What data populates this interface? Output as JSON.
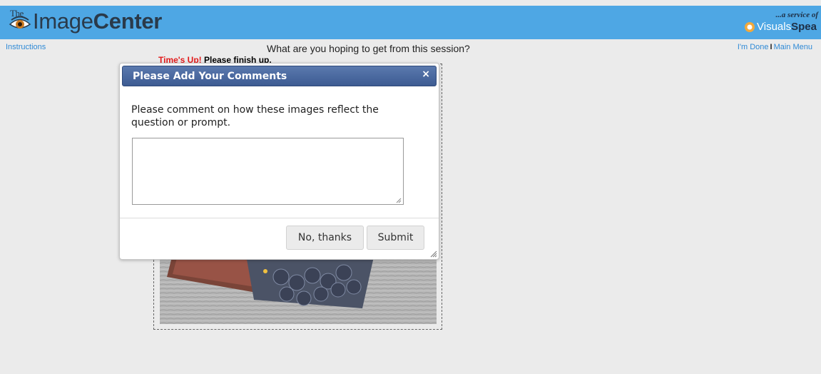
{
  "header": {
    "logo_prefix": "The",
    "logo_image": "Image",
    "logo_center": "Center",
    "service_tagline": "...a service of",
    "service_brand_light": "Visuals",
    "service_brand_bold": "Spea"
  },
  "nav": {
    "instructions": "Instructions",
    "done": "I'm Done",
    "separator": "I",
    "main_menu": "Main Menu"
  },
  "question": "What are you hoping to get from this session?",
  "timer": {
    "alert": "Time's Up!",
    "message": "Please finish up."
  },
  "dialog": {
    "title": "Please Add Your Comments",
    "close": "×",
    "prompt": "Please comment on how these images reflect the question or prompt.",
    "comment_value": "",
    "no_thanks_label": "No, thanks",
    "submit_label": "Submit"
  },
  "icons": [
    "eye-icon",
    "visuals-speak-logo-icon",
    "close-icon",
    "resize-grip-icon"
  ],
  "colors": {
    "header_bg": "#4ea7e4",
    "page_bg": "#ebebeb",
    "link": "#2f8ad6",
    "timer_alert": "#e21b1b",
    "dialog_header": "#3d5b92"
  }
}
